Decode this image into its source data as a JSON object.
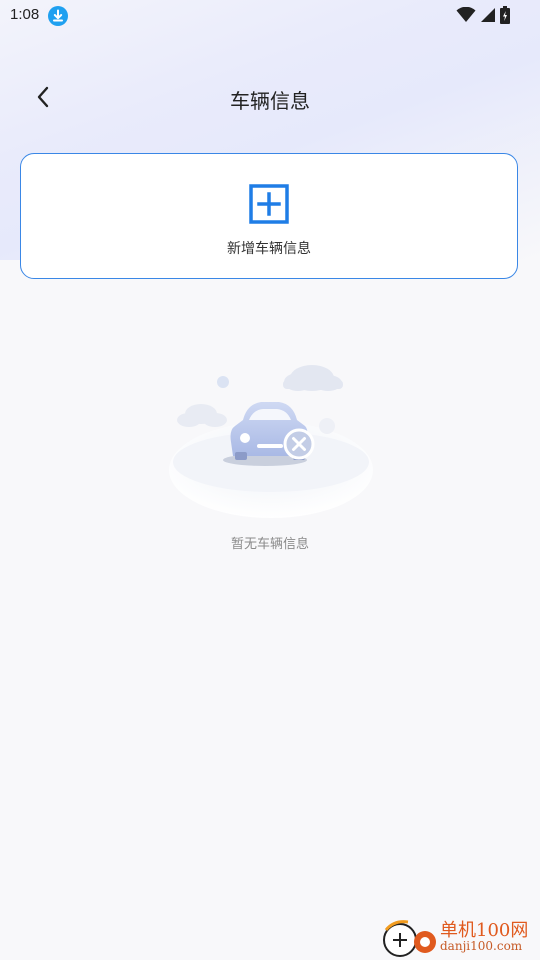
{
  "status_bar": {
    "time": "1:08",
    "icons": [
      "download-icon",
      "wifi-icon",
      "signal-icon",
      "battery-icon"
    ]
  },
  "header": {
    "back_icon": "chevron-left-icon",
    "title": "车辆信息"
  },
  "add_card": {
    "icon": "plus-square-icon",
    "label": "新增车辆信息",
    "accent_color": "#3a87e6"
  },
  "empty_state": {
    "illustration": "car-unavailable-illustration",
    "text": "暂无车辆信息"
  },
  "watermark": {
    "title": "单机100网",
    "subtitle": "danji100.com"
  }
}
